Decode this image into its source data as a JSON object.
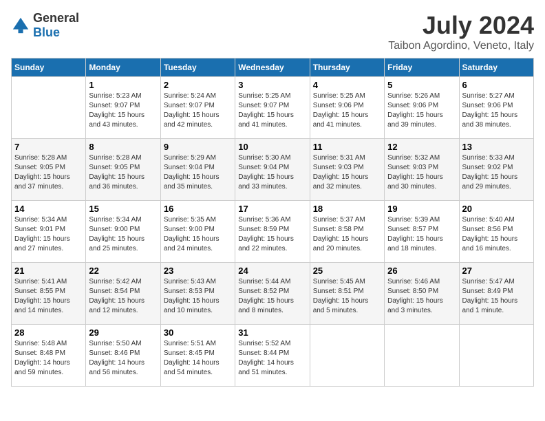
{
  "logo": {
    "general": "General",
    "blue": "Blue"
  },
  "title": "July 2024",
  "location": "Taibon Agordino, Veneto, Italy",
  "days_of_week": [
    "Sunday",
    "Monday",
    "Tuesday",
    "Wednesday",
    "Thursday",
    "Friday",
    "Saturday"
  ],
  "weeks": [
    [
      {
        "day": "",
        "sunrise": "",
        "sunset": "",
        "daylight": ""
      },
      {
        "day": "1",
        "sunrise": "Sunrise: 5:23 AM",
        "sunset": "Sunset: 9:07 PM",
        "daylight": "Daylight: 15 hours and 43 minutes."
      },
      {
        "day": "2",
        "sunrise": "Sunrise: 5:24 AM",
        "sunset": "Sunset: 9:07 PM",
        "daylight": "Daylight: 15 hours and 42 minutes."
      },
      {
        "day": "3",
        "sunrise": "Sunrise: 5:25 AM",
        "sunset": "Sunset: 9:07 PM",
        "daylight": "Daylight: 15 hours and 41 minutes."
      },
      {
        "day": "4",
        "sunrise": "Sunrise: 5:25 AM",
        "sunset": "Sunset: 9:06 PM",
        "daylight": "Daylight: 15 hours and 41 minutes."
      },
      {
        "day": "5",
        "sunrise": "Sunrise: 5:26 AM",
        "sunset": "Sunset: 9:06 PM",
        "daylight": "Daylight: 15 hours and 39 minutes."
      },
      {
        "day": "6",
        "sunrise": "Sunrise: 5:27 AM",
        "sunset": "Sunset: 9:06 PM",
        "daylight": "Daylight: 15 hours and 38 minutes."
      }
    ],
    [
      {
        "day": "7",
        "sunrise": "Sunrise: 5:28 AM",
        "sunset": "Sunset: 9:05 PM",
        "daylight": "Daylight: 15 hours and 37 minutes."
      },
      {
        "day": "8",
        "sunrise": "Sunrise: 5:28 AM",
        "sunset": "Sunset: 9:05 PM",
        "daylight": "Daylight: 15 hours and 36 minutes."
      },
      {
        "day": "9",
        "sunrise": "Sunrise: 5:29 AM",
        "sunset": "Sunset: 9:04 PM",
        "daylight": "Daylight: 15 hours and 35 minutes."
      },
      {
        "day": "10",
        "sunrise": "Sunrise: 5:30 AM",
        "sunset": "Sunset: 9:04 PM",
        "daylight": "Daylight: 15 hours and 33 minutes."
      },
      {
        "day": "11",
        "sunrise": "Sunrise: 5:31 AM",
        "sunset": "Sunset: 9:03 PM",
        "daylight": "Daylight: 15 hours and 32 minutes."
      },
      {
        "day": "12",
        "sunrise": "Sunrise: 5:32 AM",
        "sunset": "Sunset: 9:03 PM",
        "daylight": "Daylight: 15 hours and 30 minutes."
      },
      {
        "day": "13",
        "sunrise": "Sunrise: 5:33 AM",
        "sunset": "Sunset: 9:02 PM",
        "daylight": "Daylight: 15 hours and 29 minutes."
      }
    ],
    [
      {
        "day": "14",
        "sunrise": "Sunrise: 5:34 AM",
        "sunset": "Sunset: 9:01 PM",
        "daylight": "Daylight: 15 hours and 27 minutes."
      },
      {
        "day": "15",
        "sunrise": "Sunrise: 5:34 AM",
        "sunset": "Sunset: 9:00 PM",
        "daylight": "Daylight: 15 hours and 25 minutes."
      },
      {
        "day": "16",
        "sunrise": "Sunrise: 5:35 AM",
        "sunset": "Sunset: 9:00 PM",
        "daylight": "Daylight: 15 hours and 24 minutes."
      },
      {
        "day": "17",
        "sunrise": "Sunrise: 5:36 AM",
        "sunset": "Sunset: 8:59 PM",
        "daylight": "Daylight: 15 hours and 22 minutes."
      },
      {
        "day": "18",
        "sunrise": "Sunrise: 5:37 AM",
        "sunset": "Sunset: 8:58 PM",
        "daylight": "Daylight: 15 hours and 20 minutes."
      },
      {
        "day": "19",
        "sunrise": "Sunrise: 5:39 AM",
        "sunset": "Sunset: 8:57 PM",
        "daylight": "Daylight: 15 hours and 18 minutes."
      },
      {
        "day": "20",
        "sunrise": "Sunrise: 5:40 AM",
        "sunset": "Sunset: 8:56 PM",
        "daylight": "Daylight: 15 hours and 16 minutes."
      }
    ],
    [
      {
        "day": "21",
        "sunrise": "Sunrise: 5:41 AM",
        "sunset": "Sunset: 8:55 PM",
        "daylight": "Daylight: 15 hours and 14 minutes."
      },
      {
        "day": "22",
        "sunrise": "Sunrise: 5:42 AM",
        "sunset": "Sunset: 8:54 PM",
        "daylight": "Daylight: 15 hours and 12 minutes."
      },
      {
        "day": "23",
        "sunrise": "Sunrise: 5:43 AM",
        "sunset": "Sunset: 8:53 PM",
        "daylight": "Daylight: 15 hours and 10 minutes."
      },
      {
        "day": "24",
        "sunrise": "Sunrise: 5:44 AM",
        "sunset": "Sunset: 8:52 PM",
        "daylight": "Daylight: 15 hours and 8 minutes."
      },
      {
        "day": "25",
        "sunrise": "Sunrise: 5:45 AM",
        "sunset": "Sunset: 8:51 PM",
        "daylight": "Daylight: 15 hours and 5 minutes."
      },
      {
        "day": "26",
        "sunrise": "Sunrise: 5:46 AM",
        "sunset": "Sunset: 8:50 PM",
        "daylight": "Daylight: 15 hours and 3 minutes."
      },
      {
        "day": "27",
        "sunrise": "Sunrise: 5:47 AM",
        "sunset": "Sunset: 8:49 PM",
        "daylight": "Daylight: 15 hours and 1 minute."
      }
    ],
    [
      {
        "day": "28",
        "sunrise": "Sunrise: 5:48 AM",
        "sunset": "Sunset: 8:48 PM",
        "daylight": "Daylight: 14 hours and 59 minutes."
      },
      {
        "day": "29",
        "sunrise": "Sunrise: 5:50 AM",
        "sunset": "Sunset: 8:46 PM",
        "daylight": "Daylight: 14 hours and 56 minutes."
      },
      {
        "day": "30",
        "sunrise": "Sunrise: 5:51 AM",
        "sunset": "Sunset: 8:45 PM",
        "daylight": "Daylight: 14 hours and 54 minutes."
      },
      {
        "day": "31",
        "sunrise": "Sunrise: 5:52 AM",
        "sunset": "Sunset: 8:44 PM",
        "daylight": "Daylight: 14 hours and 51 minutes."
      },
      {
        "day": "",
        "sunrise": "",
        "sunset": "",
        "daylight": ""
      },
      {
        "day": "",
        "sunrise": "",
        "sunset": "",
        "daylight": ""
      },
      {
        "day": "",
        "sunrise": "",
        "sunset": "",
        "daylight": ""
      }
    ]
  ]
}
